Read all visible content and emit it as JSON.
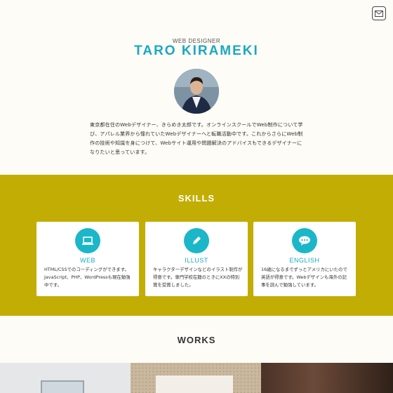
{
  "header": {
    "subtitle": "WEB DESIGNER",
    "name": "TARO KIRAMEKI",
    "mail_icon": "mail-icon"
  },
  "bio": "東京都在住のWebデザイナー、きらめき太郎です。オンラインスクールでWeb制作について学び、アパレル業界から憧れていたWebデザイナーへと転職活動中です。これからさらにWeb制作の技術や知識を身につけて、Webサイト運用や問題解決のアドバイスもできるデザイナーになりたいと思っています。",
  "skills": {
    "title": "SKILLS",
    "items": [
      {
        "icon": "laptop-icon",
        "title": "WEB",
        "text": "HTML/CSSでのコーディングができます。JavaScript、PHP、WordPressも現在勉強中です。"
      },
      {
        "icon": "pencil-icon",
        "title": "ILLUST",
        "text": "キャラクターデザインなどのイラスト制作が得意です。専門学校在籍のときにXXの特別賞を受賞しました。"
      },
      {
        "icon": "chat-bubble-icon",
        "title": "ENGLISH",
        "text": "16歳になるまでずっとアメリカにいたので英語が得意です。Webデザインも海外の記事を読んで勉強しています。"
      }
    ]
  },
  "works": {
    "title": "WORKS"
  },
  "colors": {
    "accent": "#1aa9c1",
    "skills_bg": "#c2ad04",
    "page_bg": "#fdfcf6"
  }
}
